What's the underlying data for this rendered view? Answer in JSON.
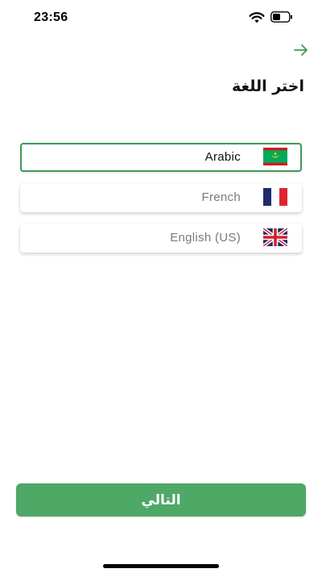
{
  "status_bar": {
    "time": "23:56",
    "icons": [
      "wifi-icon",
      "battery-icon"
    ]
  },
  "header": {
    "back_icon": "arrow-right-icon",
    "title": "اختر اللغة"
  },
  "languages": [
    {
      "label": "Arabic",
      "flag": "mauritania-flag-icon",
      "selected": true
    },
    {
      "label": "French",
      "flag": "france-flag-icon",
      "selected": false
    },
    {
      "label": "English (US)",
      "flag": "uk-flag-icon",
      "selected": false
    }
  ],
  "footer": {
    "next_label": "التالي"
  },
  "colors": {
    "accent": "#4ea866",
    "selected_border": "#3e9a58",
    "arrow": "#3e9a58"
  }
}
